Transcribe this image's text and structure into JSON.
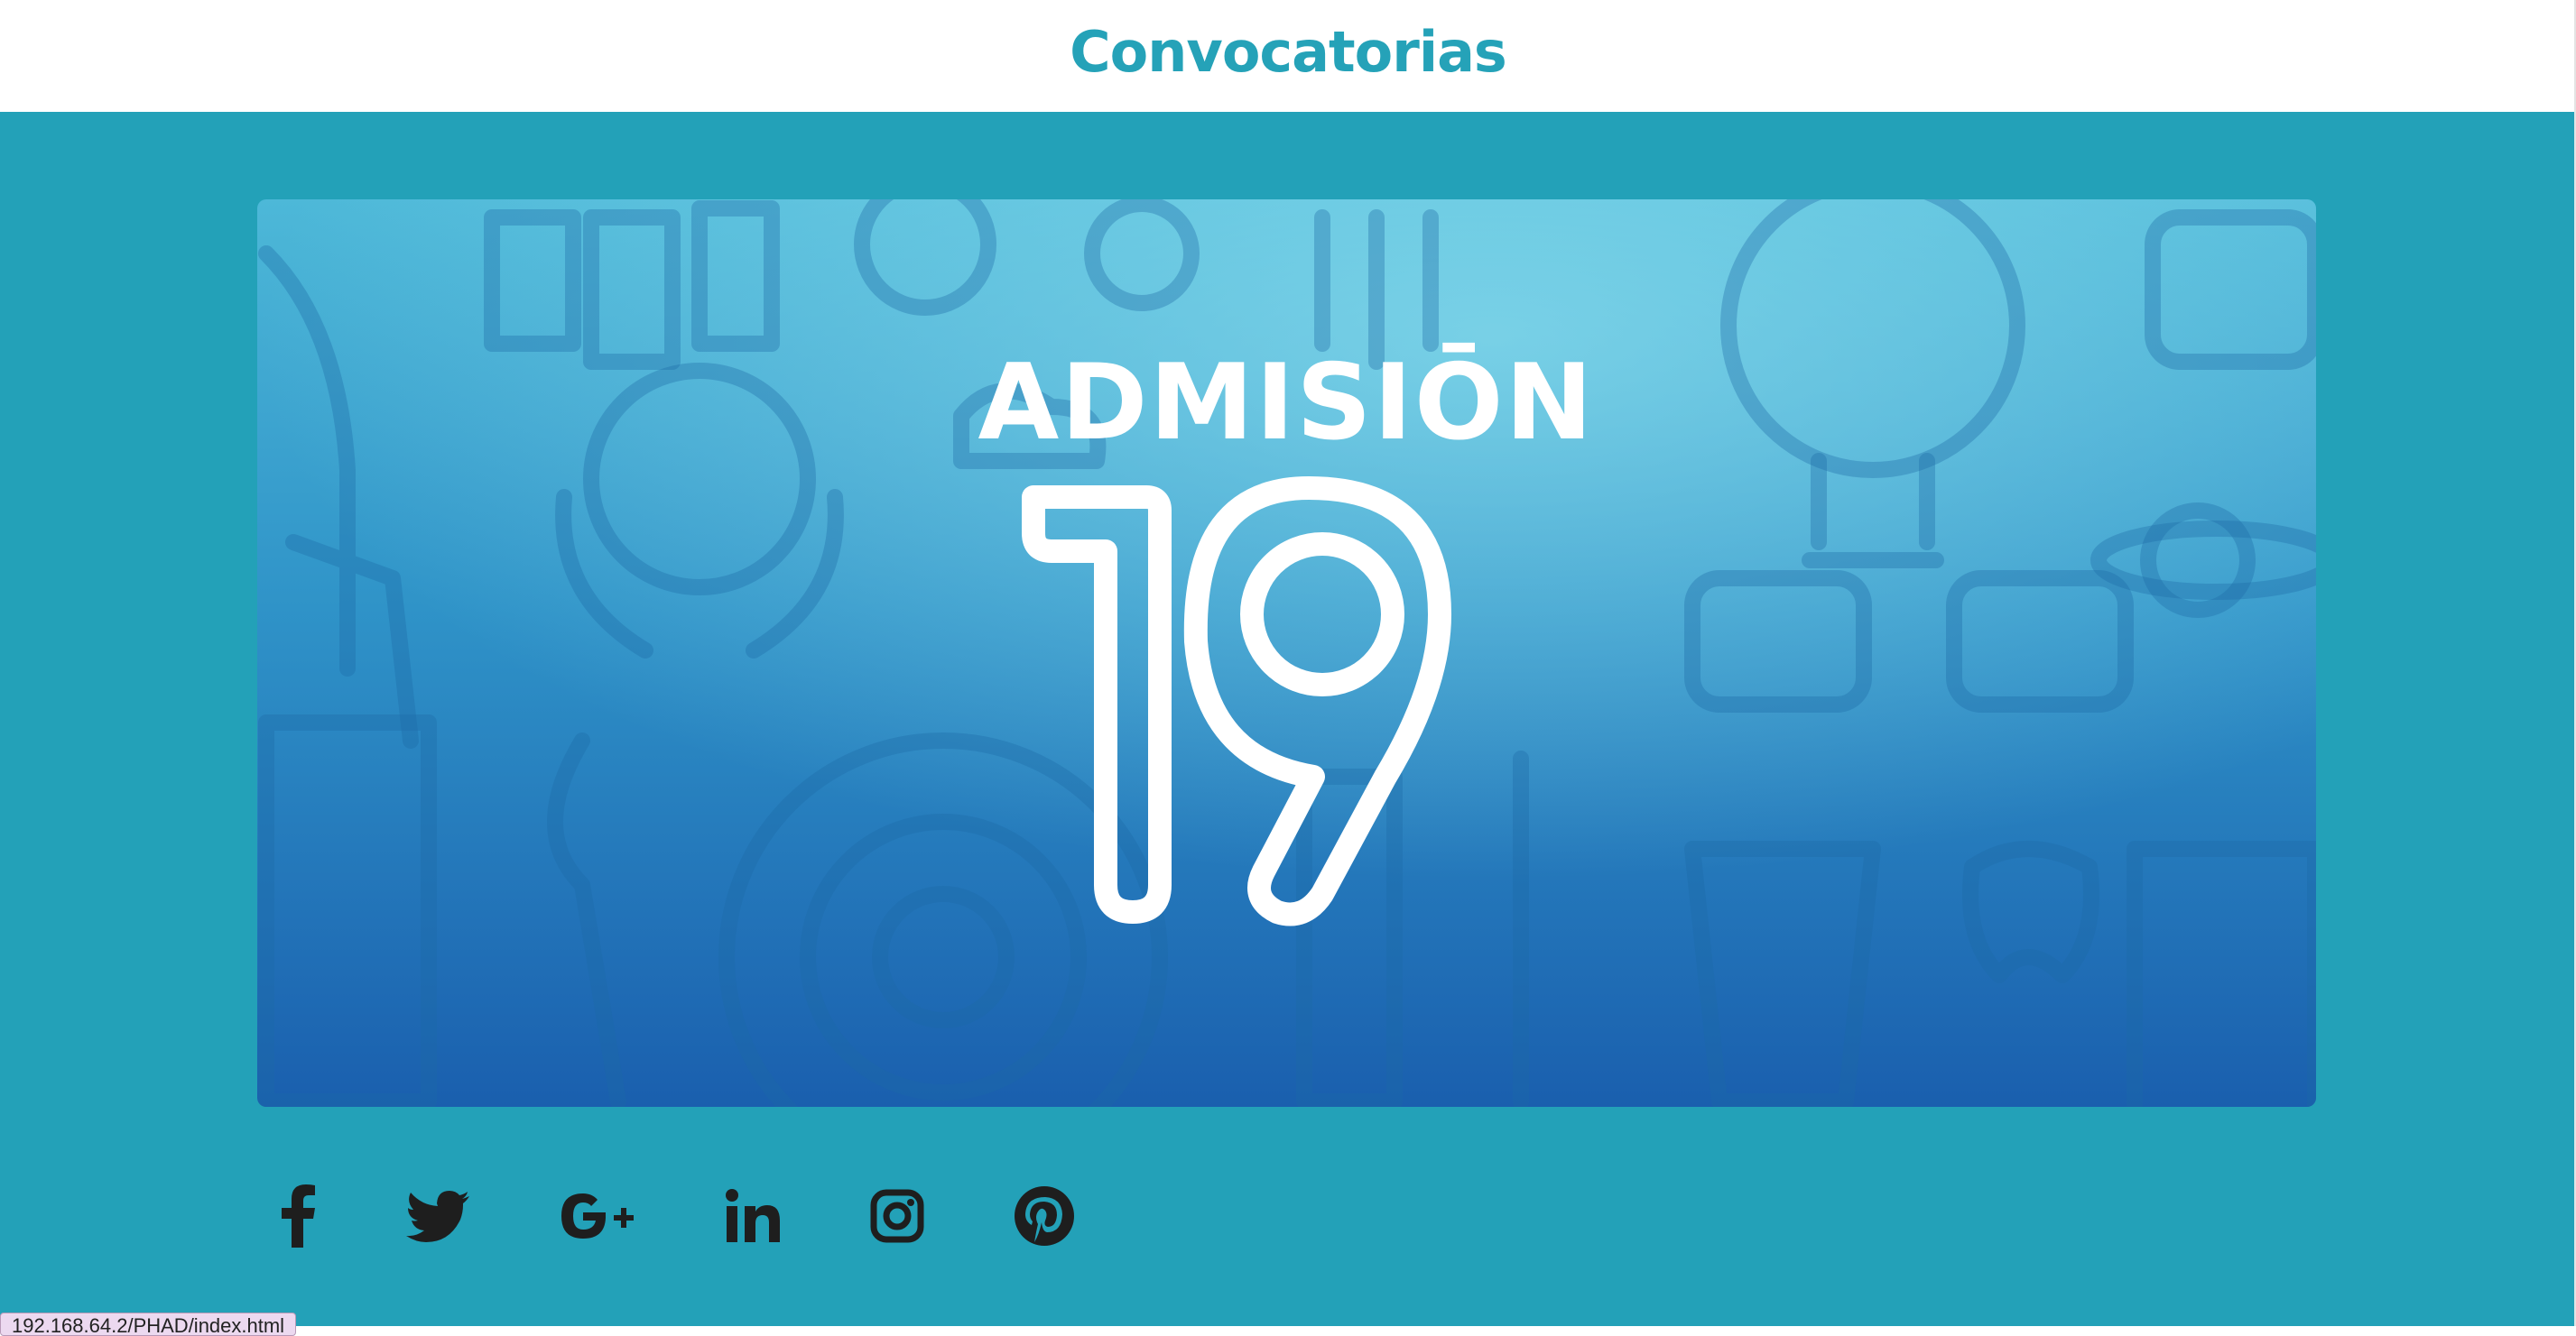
{
  "header": {
    "title": "Convocatorias"
  },
  "banner": {
    "heading": "ADMISIŌN",
    "number": "19",
    "alt": "Admisión 19 banner"
  },
  "social": {
    "items": [
      {
        "name": "facebook",
        "icon": "facebook-icon"
      },
      {
        "name": "twitter",
        "icon": "twitter-icon"
      },
      {
        "name": "google-plus",
        "icon": "google-plus-icon"
      },
      {
        "name": "linkedin",
        "icon": "linkedin-icon"
      },
      {
        "name": "instagram",
        "icon": "instagram-icon"
      },
      {
        "name": "pinterest",
        "icon": "pinterest-icon"
      }
    ]
  },
  "status_bar": {
    "url": "192.168.64.2/PHAD/index.html"
  },
  "colors": {
    "accent": "#25a2b8",
    "background": "#23a1b8",
    "icon": "#1e1e1e"
  }
}
